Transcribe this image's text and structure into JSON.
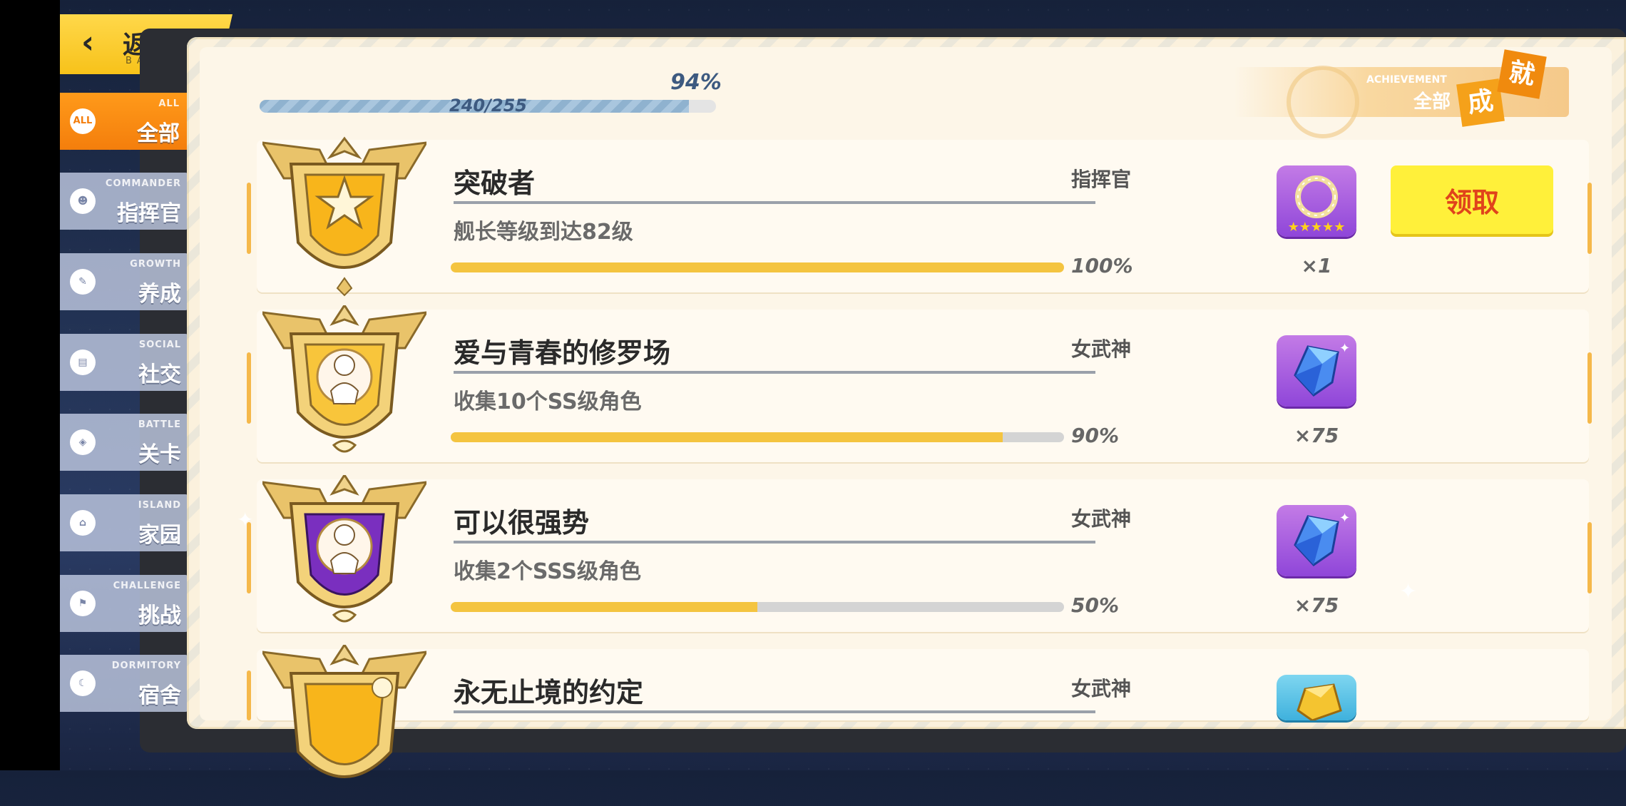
{
  "back": {
    "label": "返回",
    "sub": "BACK"
  },
  "sidebar": {
    "items": [
      {
        "en": "ALL",
        "cn": "全部",
        "icon": "ALL",
        "active": true
      },
      {
        "en": "COMMANDER",
        "cn": "指挥官",
        "icon": "☻",
        "active": false
      },
      {
        "en": "GROWTH",
        "cn": "养成",
        "icon": "✎",
        "active": false
      },
      {
        "en": "SOCIAL",
        "cn": "社交",
        "icon": "▤",
        "active": false
      },
      {
        "en": "BATTLE",
        "cn": "关卡",
        "icon": "◈",
        "active": false
      },
      {
        "en": "ISLAND",
        "cn": "家园",
        "icon": "⌂",
        "active": false
      },
      {
        "en": "CHALLENGE",
        "cn": "挑战",
        "icon": "⚑",
        "active": false
      },
      {
        "en": "DORMITORY",
        "cn": "宿舍",
        "icon": "☾",
        "active": false
      }
    ]
  },
  "progress": {
    "percent_label": "94%",
    "count": "240/255",
    "fraction": 0.94
  },
  "achievement_badge": {
    "en": "ACHIEVEMENT",
    "cn": "全部",
    "tag1": "成",
    "tag2": "就"
  },
  "achievements": [
    {
      "title": "突破者",
      "category": "指挥官",
      "desc": "舰长等级到达82级",
      "pct_label": "100%",
      "progress": 1.0,
      "reward_qty": "×1",
      "reward_icon": "laurel-wreath-icon",
      "claim_label": "领取"
    },
    {
      "title": "爱与青春的修罗场",
      "category": "女武神",
      "desc": "收集10个SS级角色",
      "pct_label": "90%",
      "progress": 0.9,
      "reward_qty": "×75",
      "reward_icon": "crystal-icon"
    },
    {
      "title": "可以很强势",
      "category": "女武神",
      "desc": "收集2个SSS级角色",
      "pct_label": "50%",
      "progress": 0.5,
      "reward_qty": "×75",
      "reward_icon": "crystal-icon"
    },
    {
      "title": "永无止境的约定",
      "category": "女武神",
      "desc": "",
      "pct_label": "",
      "progress": null,
      "reward_qty": "",
      "reward_icon": "gold-crystal-icon"
    }
  ],
  "colors": {
    "accent": "#f47e0c",
    "progress_fill": "#f4c440",
    "claim_bg": "#fff03a",
    "claim_text": "#e0431b"
  }
}
